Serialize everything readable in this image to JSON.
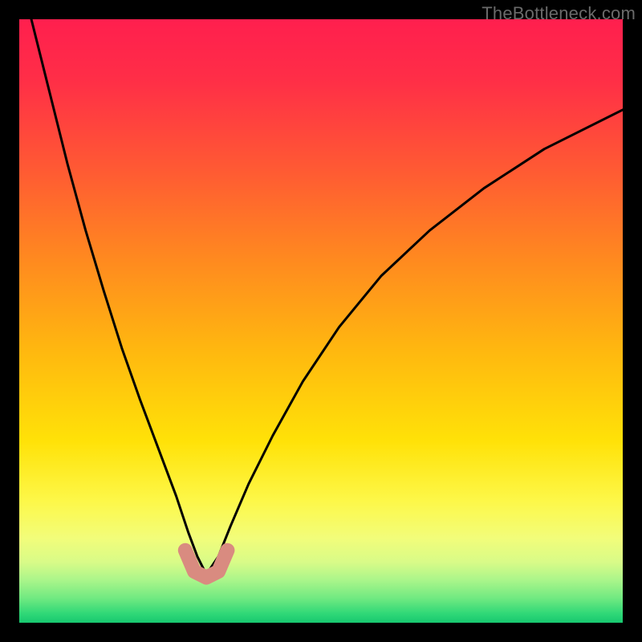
{
  "watermark": "TheBottleneck.com",
  "chart_data": {
    "type": "line",
    "title": "",
    "xlabel": "",
    "ylabel": "",
    "xlim": [
      0,
      100
    ],
    "ylim": [
      0,
      100
    ],
    "grid": false,
    "legend": false,
    "notes": "Vertical gradient background from red (top) through orange/yellow to green (bottom). Black V-shaped curve with minimum near x≈31. Salmon segment overlay near the trough.",
    "series": [
      {
        "name": "black-curve",
        "color": "#000000",
        "x": [
          2,
          5,
          8,
          11,
          14,
          17,
          20,
          23,
          26,
          28,
          29.5,
          31,
          33,
          35,
          38,
          42,
          47,
          53,
          60,
          68,
          77,
          87,
          100
        ],
        "values": [
          100,
          88,
          76,
          65,
          55,
          45.5,
          37,
          29,
          21,
          15,
          11,
          8,
          11,
          16,
          23,
          31,
          40,
          49,
          57.5,
          65,
          72,
          78.5,
          85
        ]
      },
      {
        "name": "salmon-segment",
        "color": "#d98b80",
        "x": [
          27.5,
          29,
          31,
          33,
          34.5
        ],
        "values": [
          12,
          8.5,
          7.5,
          8.5,
          12
        ]
      }
    ],
    "background_gradient_stops": [
      {
        "pos": 0.0,
        "color": "#ff1f4e"
      },
      {
        "pos": 0.1,
        "color": "#ff2e47"
      },
      {
        "pos": 0.25,
        "color": "#ff5a33"
      },
      {
        "pos": 0.4,
        "color": "#ff8a1f"
      },
      {
        "pos": 0.55,
        "color": "#ffb80f"
      },
      {
        "pos": 0.7,
        "color": "#ffe208"
      },
      {
        "pos": 0.8,
        "color": "#fdf84a"
      },
      {
        "pos": 0.86,
        "color": "#f2fd7a"
      },
      {
        "pos": 0.9,
        "color": "#d8fb88"
      },
      {
        "pos": 0.93,
        "color": "#a9f58a"
      },
      {
        "pos": 0.96,
        "color": "#6fe981"
      },
      {
        "pos": 0.985,
        "color": "#2fd877"
      },
      {
        "pos": 1.0,
        "color": "#18c86f"
      }
    ]
  }
}
